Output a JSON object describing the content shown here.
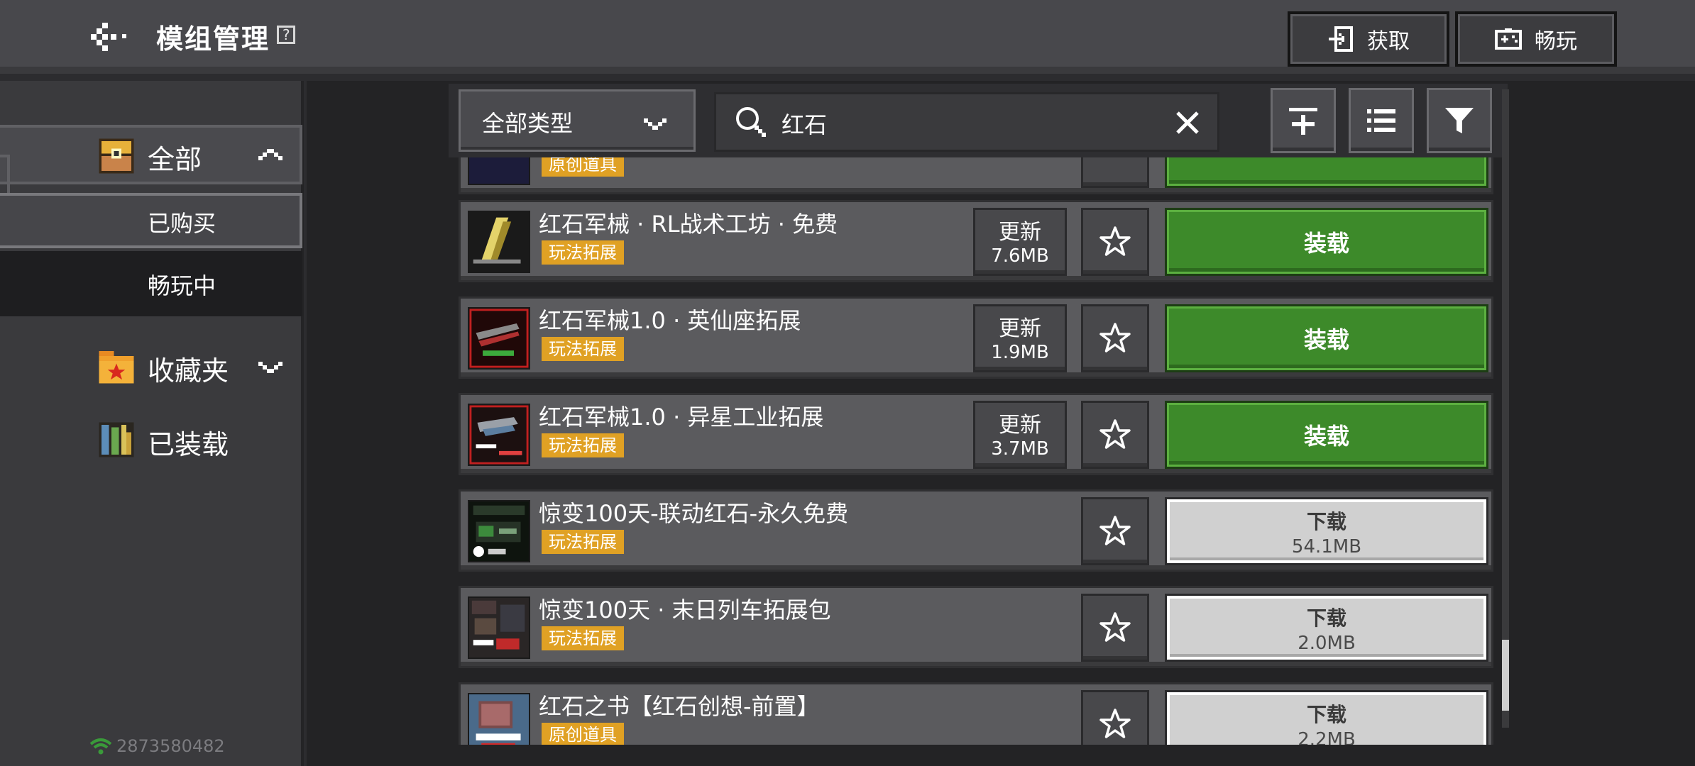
{
  "header": {
    "title": "模组管理",
    "help_symbol": "?",
    "get_button": "获取",
    "play_button": "畅玩"
  },
  "sidebar": {
    "all": "全部",
    "bought": "已购买",
    "playing": "畅玩中",
    "favorites": "收藏夹",
    "installed": "已装载",
    "user_id": "2873580482"
  },
  "toolbar": {
    "type_select": "全部类型",
    "search_value": "红石"
  },
  "list": {
    "partial_top_tag": "原创道具",
    "items": [
      {
        "title": "红石军械 · RL战术工坊 · 免费",
        "tag": "玩法拓展",
        "update_label": "更新",
        "update_size": "7.6MB",
        "action": "装载"
      },
      {
        "title": "红石军械1.0 · 英仙座拓展",
        "tag": "玩法拓展",
        "update_label": "更新",
        "update_size": "1.9MB",
        "action": "装载"
      },
      {
        "title": "红石军械1.0 · 异星工业拓展",
        "tag": "玩法拓展",
        "update_label": "更新",
        "update_size": "3.7MB",
        "action": "装载"
      },
      {
        "title": "惊变100天-联动红石-永久免费",
        "tag": "玩法拓展",
        "action": "下载",
        "action_size": "54.1MB"
      },
      {
        "title": "惊变100天 · 末日列车拓展包",
        "tag": "玩法拓展",
        "action": "下载",
        "action_size": "2.0MB"
      },
      {
        "title": "红石之书【红石创想-前置】",
        "tag": "原创道具",
        "action": "下载",
        "action_size": "2.2MB"
      }
    ]
  },
  "colors": {
    "tag": "#e0a124",
    "load_button": "#3d8a2a",
    "download_button": "#d0d0d0"
  }
}
